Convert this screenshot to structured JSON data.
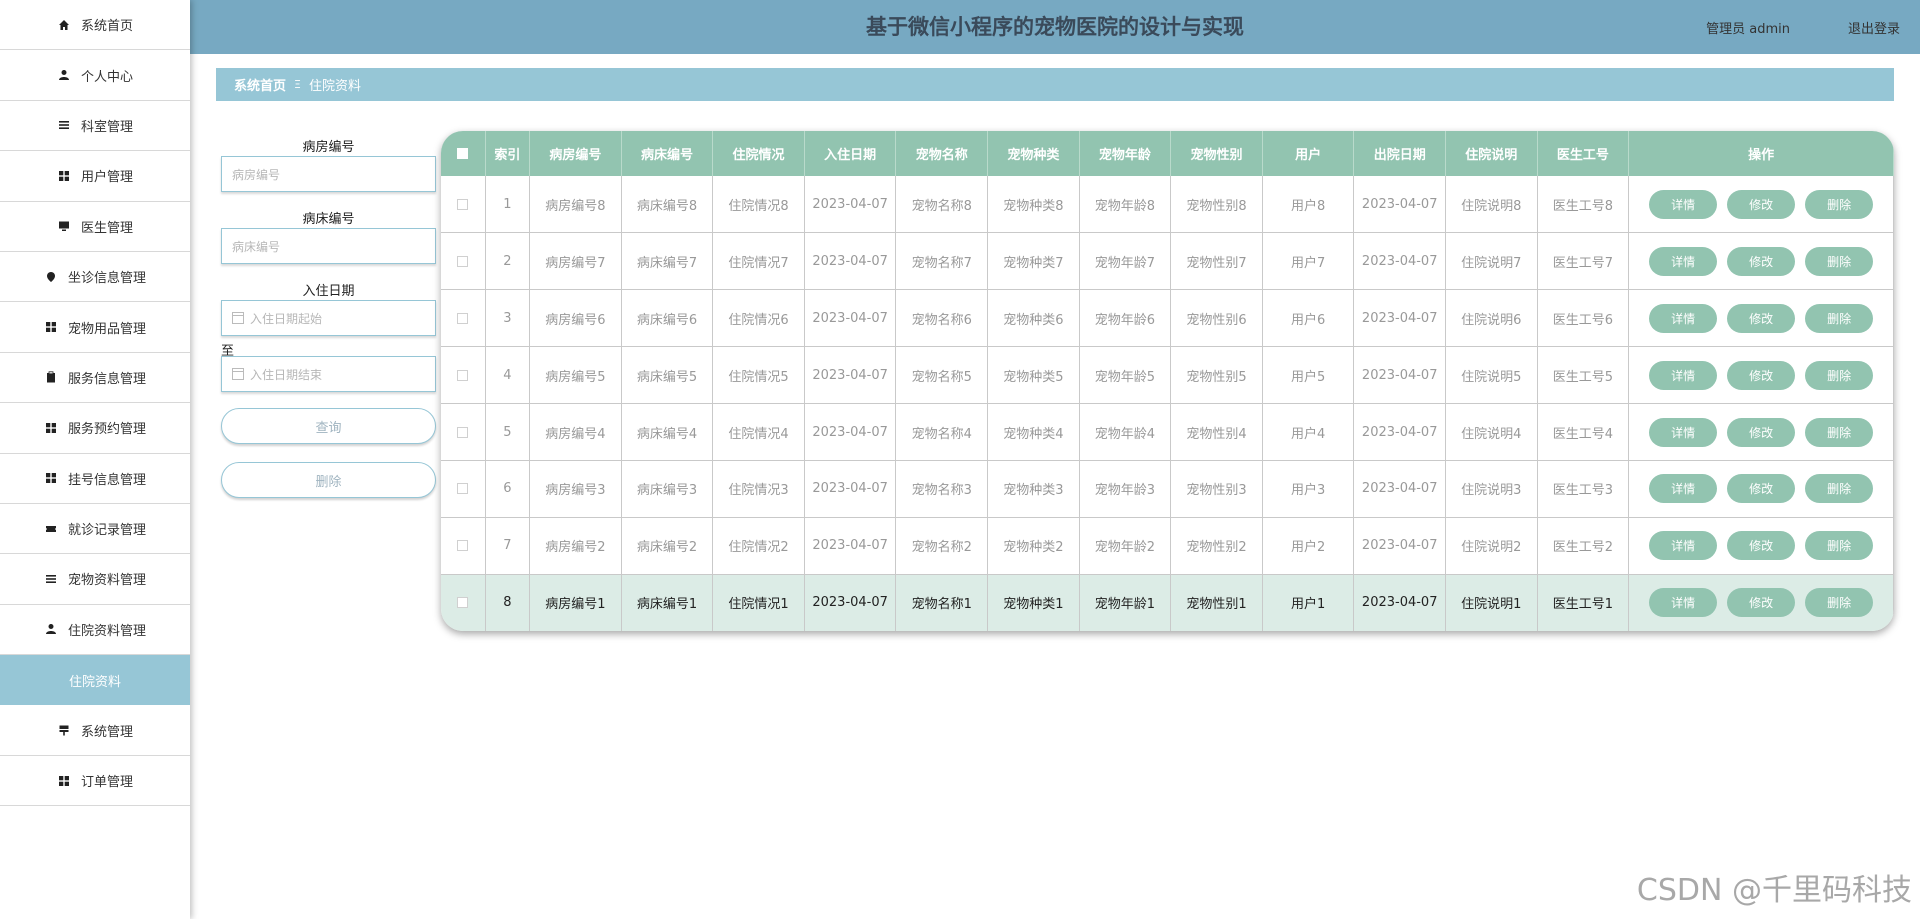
{
  "sidebar": {
    "items": [
      {
        "label": "系统首页",
        "icon": "home-icon"
      },
      {
        "label": "个人中心",
        "icon": "person-icon"
      },
      {
        "label": "科室管理",
        "icon": "list-icon"
      },
      {
        "label": "用户管理",
        "icon": "grid-icon"
      },
      {
        "label": "医生管理",
        "icon": "monitor-icon"
      },
      {
        "label": "坐诊信息管理",
        "icon": "pin-icon"
      },
      {
        "label": "宠物用品管理",
        "icon": "grid-icon"
      },
      {
        "label": "服务信息管理",
        "icon": "clipboard-icon"
      },
      {
        "label": "服务预约管理",
        "icon": "grid-icon"
      },
      {
        "label": "挂号信息管理",
        "icon": "grid-icon"
      },
      {
        "label": "就诊记录管理",
        "icon": "ticket-icon"
      },
      {
        "label": "宠物资料管理",
        "icon": "list-icon"
      },
      {
        "label": "住院资料管理",
        "icon": "person-icon"
      },
      {
        "label": "住院资料",
        "icon": "",
        "active": true
      },
      {
        "label": "系统管理",
        "icon": "signpost-icon"
      },
      {
        "label": "订单管理",
        "icon": "grid-icon"
      }
    ]
  },
  "header": {
    "title": "基于微信小程序的宠物医院的设计与实现",
    "user": "管理员 admin",
    "logout": "退出登录"
  },
  "breadcrumb": {
    "home": "系统首页",
    "separator": "Ξ",
    "current": "住院资料"
  },
  "search": {
    "room_label": "病房编号",
    "room_placeholder": "病房编号",
    "bed_label": "病床编号",
    "bed_placeholder": "病床编号",
    "date_label": "入住日期",
    "date_start_placeholder": "入住日期起始",
    "to_label": "至",
    "date_end_placeholder": "入住日期结束",
    "query_button": "查询",
    "delete_button": "删除"
  },
  "table": {
    "headers": [
      "索引",
      "病房编号",
      "病床编号",
      "住院情况",
      "入住日期",
      "宠物名称",
      "宠物种类",
      "宠物年龄",
      "宠物性别",
      "用户",
      "出院日期",
      "住院说明",
      "医生工号",
      "操作"
    ],
    "actions": {
      "detail": "详情",
      "edit": "修改",
      "delete": "删除"
    },
    "rows": [
      [
        "1",
        "病房编号8",
        "病床编号8",
        "住院情况8",
        "2023-04-07",
        "宠物名称8",
        "宠物种类8",
        "宠物年龄8",
        "宠物性别8",
        "用户8",
        "2023-04-07",
        "住院说明8",
        "医生工号8"
      ],
      [
        "2",
        "病房编号7",
        "病床编号7",
        "住院情况7",
        "2023-04-07",
        "宠物名称7",
        "宠物种类7",
        "宠物年龄7",
        "宠物性别7",
        "用户7",
        "2023-04-07",
        "住院说明7",
        "医生工号7"
      ],
      [
        "3",
        "病房编号6",
        "病床编号6",
        "住院情况6",
        "2023-04-07",
        "宠物名称6",
        "宠物种类6",
        "宠物年龄6",
        "宠物性别6",
        "用户6",
        "2023-04-07",
        "住院说明6",
        "医生工号6"
      ],
      [
        "4",
        "病房编号5",
        "病床编号5",
        "住院情况5",
        "2023-04-07",
        "宠物名称5",
        "宠物种类5",
        "宠物年龄5",
        "宠物性别5",
        "用户5",
        "2023-04-07",
        "住院说明5",
        "医生工号5"
      ],
      [
        "5",
        "病房编号4",
        "病床编号4",
        "住院情况4",
        "2023-04-07",
        "宠物名称4",
        "宠物种类4",
        "宠物年龄4",
        "宠物性别4",
        "用户4",
        "2023-04-07",
        "住院说明4",
        "医生工号4"
      ],
      [
        "6",
        "病房编号3",
        "病床编号3",
        "住院情况3",
        "2023-04-07",
        "宠物名称3",
        "宠物种类3",
        "宠物年龄3",
        "宠物性别3",
        "用户3",
        "2023-04-07",
        "住院说明3",
        "医生工号3"
      ],
      [
        "7",
        "病房编号2",
        "病床编号2",
        "住院情况2",
        "2023-04-07",
        "宠物名称2",
        "宠物种类2",
        "宠物年龄2",
        "宠物性别2",
        "用户2",
        "2023-04-07",
        "住院说明2",
        "医生工号2"
      ],
      [
        "8",
        "病房编号1",
        "病床编号1",
        "住院情况1",
        "2023-04-07",
        "宠物名称1",
        "宠物种类1",
        "宠物年龄1",
        "宠物性别1",
        "用户1",
        "2023-04-07",
        "住院说明1",
        "医生工号1"
      ]
    ]
  },
  "watermark": "CSDN @千里码科技",
  "colors": {
    "header_bg": "#77a9c2",
    "breadcrumb_bg": "#96c6d6",
    "table_header_bg": "#92c4b0",
    "highlight_row_bg": "#dcece6"
  }
}
